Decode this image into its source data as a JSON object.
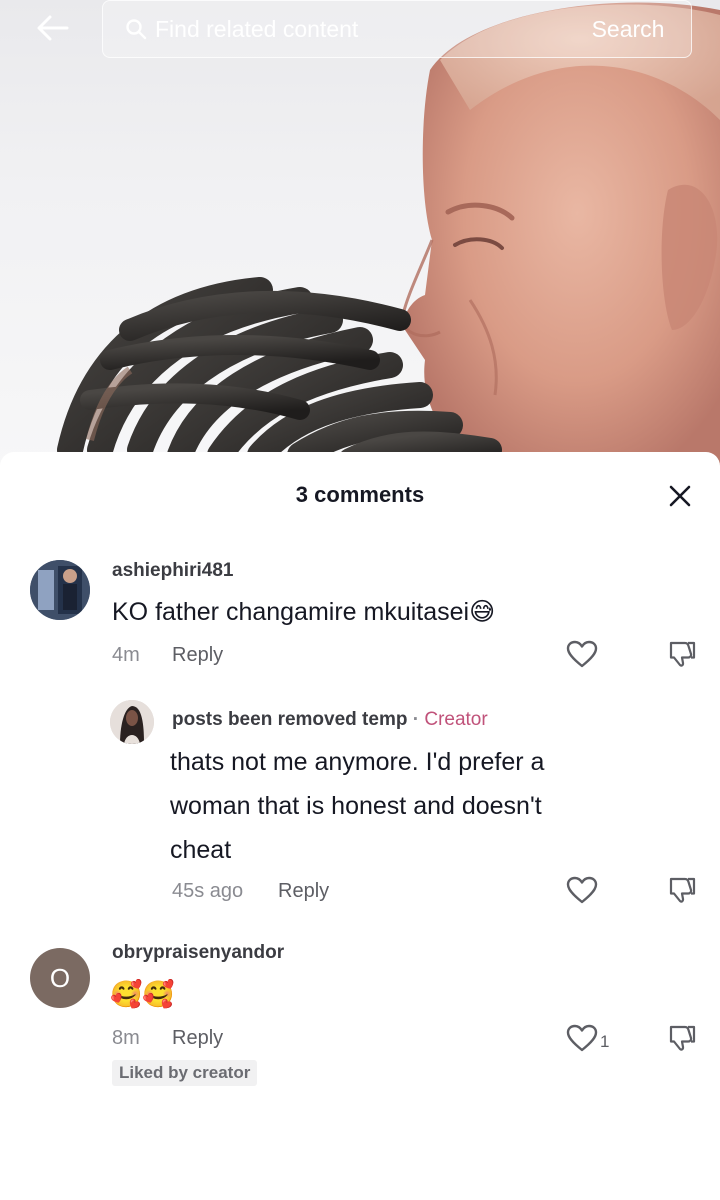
{
  "search": {
    "placeholder": "Find related content",
    "button_label": "Search"
  },
  "sheet": {
    "title": "3 comments"
  },
  "comments": [
    {
      "username": "ashiephiri481",
      "text": "KO father changamire mkuitasei",
      "emoji": "😅",
      "time": "4m",
      "reply_label": "Reply",
      "like_count": ""
    },
    {
      "username": "posts been removed temp",
      "creator_label": "Creator",
      "separator": "·",
      "lines": [
        "thats not me anymore. I'd prefer a",
        "woman that is honest and doesn't",
        "cheat"
      ],
      "time": "45s ago",
      "reply_label": "Reply",
      "like_count": ""
    },
    {
      "username": "obrypraisenyandor",
      "avatar_letter": "O",
      "emoji": "🥰🥰",
      "time": "8m",
      "reply_label": "Reply",
      "like_count": "1",
      "badge": "Liked by creator"
    }
  ],
  "colors": {
    "creator_accent": "#c0527a",
    "avatar_letter_bg": "#7b6a62",
    "text_primary": "#161823",
    "text_secondary": "#8a8b91"
  }
}
